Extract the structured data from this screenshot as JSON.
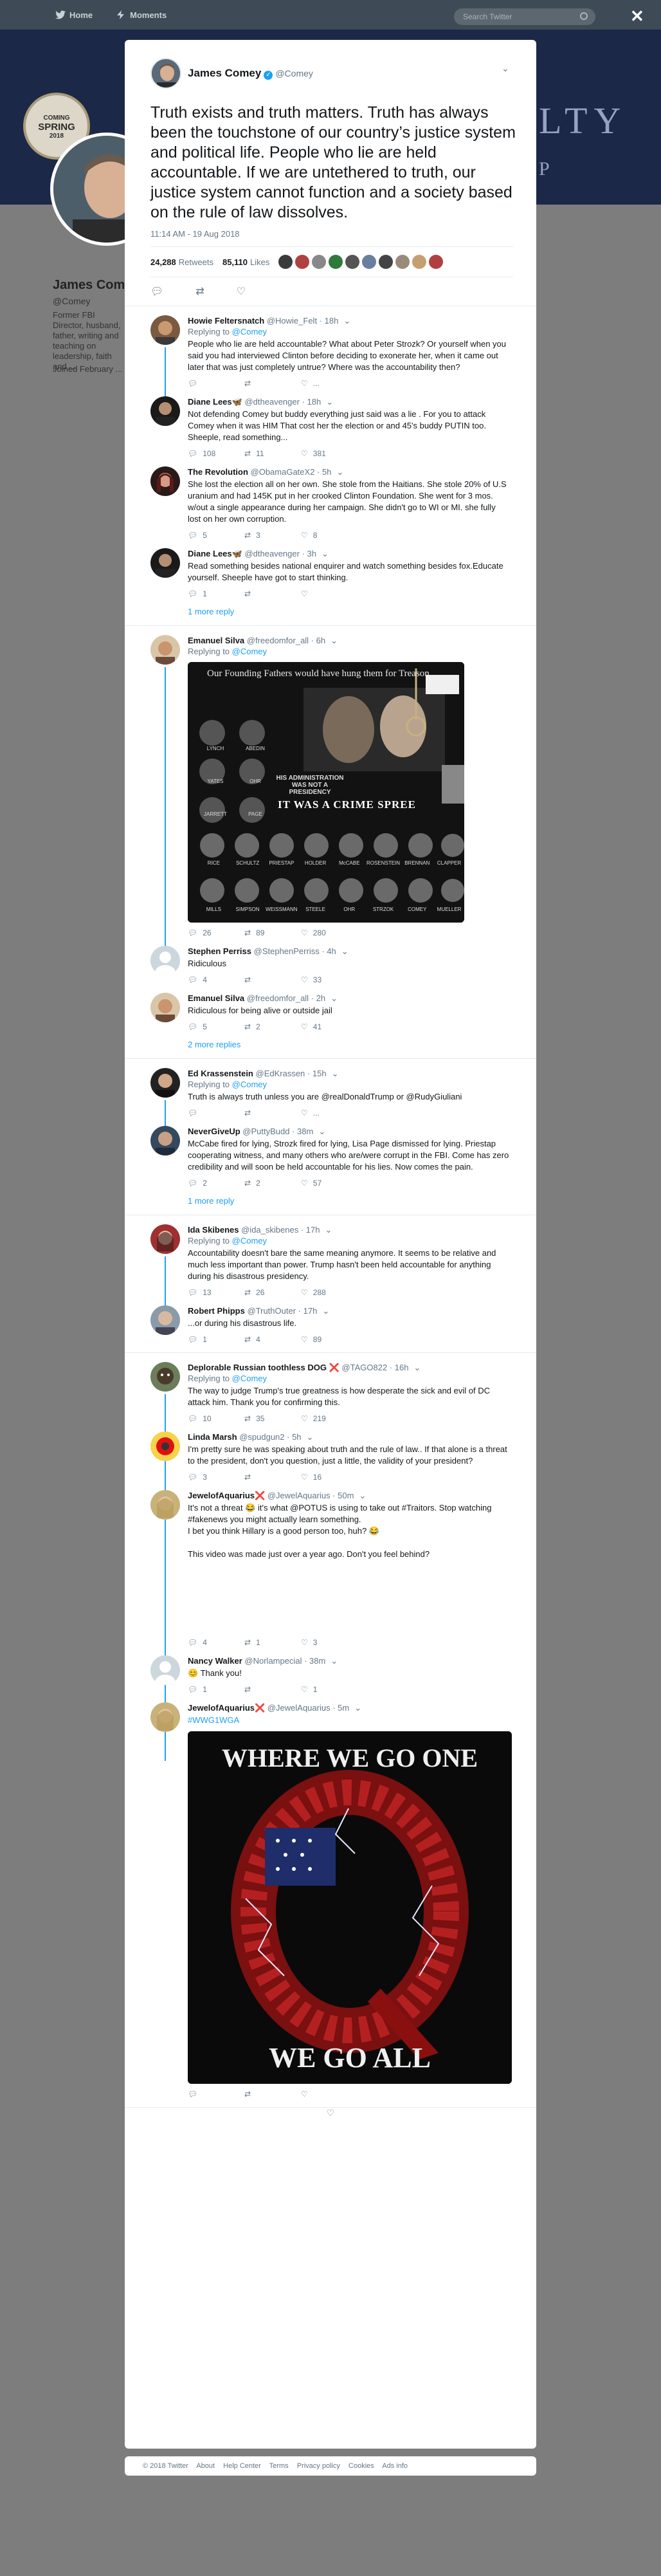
{
  "nav": {
    "home": "Home",
    "moments": "Moments",
    "search_placeholder": "Search Twitter"
  },
  "banner": {
    "seal_top": "COMING",
    "seal_big": "SPRING",
    "seal_year": "2018",
    "word": "LTY",
    "word2": "P"
  },
  "profile": {
    "name": "James Comey",
    "handle": "@Comey",
    "bio": "Former FBI Director, husband, father, writing and teaching on leadership, faith and ...",
    "joined": "Joined February ..."
  },
  "tweet": {
    "name": "James Comey",
    "handle": "@Comey",
    "text": "Truth exists and truth matters. Truth has always been the touchstone of our country’s justice system and political life. People who lie are held accountable. If we are untethered to truth, our justice system cannot function and a society based on the rule of law dissolves.",
    "time": "11:14 AM - 19 Aug 2018",
    "retweets": "24,288",
    "retweets_label": "Retweets",
    "likes": "85,110",
    "likes_label": "Likes"
  },
  "replies": [
    {
      "name": "Howie Feltersnatch",
      "handle": "@Howie_Felt",
      "time": "18h",
      "replying": "@Comey",
      "text": "People who lie are held accountable? What about Peter Strozk? Or yourself when you said you had interviewed Clinton before deciding to exonerate her, when it came out later that was just completely untrue? Where was the accountability then?",
      "reply_count": "",
      "rt_count": "",
      "like_count": "..."
    },
    {
      "name": "Diane Lees🦋",
      "handle": "@dtheavenger",
      "time": "18h",
      "replying": "",
      "text": "Not defending Comey but buddy everything just said was a lie . For you to attack Comey when it was HIM That cost her the election or and 45's buddy PUTIN too. Sheeple, read something...",
      "reply_count": "108",
      "rt_count": "11",
      "like_count": "381"
    },
    {
      "name": "The Revolution",
      "handle": "@ObamaGateX2",
      "time": "5h",
      "replying": "",
      "text": "She lost the election all on her own. She stole from the Haitians. She stole 20% of U.S uranium and had 145K put in her crooked Clinton Foundation. She went for 3 mos. w/out a single appearance during her campaign. She didn't go to WI or MI. she fully lost on her own corruption.",
      "reply_count": "5",
      "rt_count": "3",
      "like_count": "8"
    },
    {
      "name": "Diane Lees🦋",
      "handle": "@dtheavenger",
      "time": "3h",
      "replying": "",
      "text": "Read something besides national enquirer and watch something besides fox.Educate yourself. Sheeple have got to start thinking.",
      "reply_count": "1",
      "rt_count": "",
      "like_count": ""
    },
    {
      "more": "1 more reply"
    },
    {
      "name": "Emanuel Silva",
      "handle": "@freedomfor_all",
      "time": "6h",
      "replying": "@Comey",
      "text": "",
      "image_caption": "Our Founding Fathers would have hung them for Treason.",
      "image_sub": "HIS ADMINISTRATION WAS NOT A PRESIDENCY",
      "image_main": "IT WAS A CRIME SPREE",
      "image_names_row1": [
        "LYNCH",
        "ABEDIN",
        "YATES",
        "OHR",
        "JARRETT",
        "PAGE"
      ],
      "image_names_row2": [
        "RICE",
        "SCHULTZ",
        "PRIESTAP",
        "HOLDER",
        "McCABE",
        "ROSENSTEIN",
        "BRENNAN",
        "CLAPPER"
      ],
      "image_names_row3": [
        "MILLS",
        "SIMPSON",
        "WEISSMANN",
        "STEELE",
        "OHR",
        "STRZOK",
        "COMEY",
        "MUELLER"
      ],
      "reply_count": "26",
      "rt_count": "89",
      "like_count": "280"
    },
    {
      "name": "Stephen Perriss",
      "handle": "@StephenPerriss",
      "time": "4h",
      "replying": "",
      "text": "Ridiculous",
      "reply_count": "4",
      "rt_count": "",
      "like_count": "33"
    },
    {
      "name": "Emanuel Silva",
      "handle": "@freedomfor_all",
      "time": "2h",
      "replying": "",
      "text": "Ridiculous for being alive or outside jail",
      "reply_count": "5",
      "rt_count": "2",
      "like_count": "41"
    },
    {
      "more": "2 more replies"
    },
    {
      "name": "Ed Krassenstein",
      "handle": "@EdKrassen",
      "time": "15h",
      "replying": "@Comey",
      "text": "Truth is always truth unless you are @realDonaldTrump or @RudyGiuliani",
      "reply_count": "",
      "rt_count": "",
      "like_count": "..."
    },
    {
      "name": "NeverGiveUp",
      "handle": "@PuttyBudd",
      "time": "38m",
      "replying": "",
      "text": "McCabe fired for lying, Strozk fired for lying, Lisa Page dismissed for lying. Priestap cooperating witness, and many others who are/were corrupt in the FBI. Come has zero credibility and will soon be held accountable for his lies. Now comes the pain.",
      "reply_count": "2",
      "rt_count": "2",
      "like_count": "57"
    },
    {
      "more": "1 more reply"
    },
    {
      "name": "Ida Skibenes",
      "handle": "@ida_skibenes",
      "time": "17h",
      "replying": "@Comey",
      "text": "Accountability doesn't bare the same meaning anymore. It seems to be relative and much less important than power. Trump hasn't been held accountable for anything during his disastrous presidency.",
      "reply_count": "13",
      "rt_count": "26",
      "like_count": "288"
    },
    {
      "name": "Robert Phipps",
      "handle": "@TruthOuter",
      "time": "17h",
      "replying": "",
      "text": "...or during his disastrous life.",
      "reply_count": "1",
      "rt_count": "4",
      "like_count": "89"
    },
    {
      "name": "Deplorable Russian toothless DOG ❌",
      "handle": "@TAGO822",
      "time": "16h",
      "replying": "@Comey",
      "text": "The way to judge Trump's true greatness is how desperate the sick and evil of DC attack him. Thank you for confirming this.",
      "reply_count": "10",
      "rt_count": "35",
      "like_count": "219"
    },
    {
      "name": "Linda Marsh",
      "handle": "@spudgun2",
      "time": "5h",
      "replying": "",
      "text": "I'm pretty sure he was speaking about truth and the rule of law.. If that alone is a threat to the president, don't you question, just a little, the validity of your president?",
      "reply_count": "3",
      "rt_count": "",
      "like_count": "16"
    },
    {
      "name": "JewelofAquarius❌",
      "handle": "@JewelAquarius",
      "time": "50m",
      "replying": "",
      "text": "It's not a threat 😂 it's what @POTUS is using to take out #Traitors. Stop watching #fakenews you might actually learn something.\nI bet you think Hillary is a good person too, huh? 😂\n\nThis video was made just over a year ago. Don't you feel behind?",
      "reply_count": "4",
      "rt_count": "1",
      "like_count": "3"
    },
    {
      "name": "Nancy Walker",
      "handle": "@Norlampecial",
      "time": "38m",
      "replying": "",
      "text": "😊 Thank you!",
      "reply_count": "1",
      "rt_count": "",
      "like_count": "1"
    },
    {
      "name": "JewelofAquarius❌",
      "handle": "@JewelAquarius",
      "time": "5m",
      "replying": "",
      "text": "#WWG1WGA",
      "image_top": "WHERE WE GO ONE",
      "image_bottom": "WE GO ALL",
      "reply_count": "",
      "rt_count": "",
      "like_count": ""
    }
  ],
  "footer": [
    "© 2018 Twitter",
    "About",
    "Help Center",
    "Terms",
    "Privacy policy",
    "Cookies",
    "Ads info"
  ]
}
